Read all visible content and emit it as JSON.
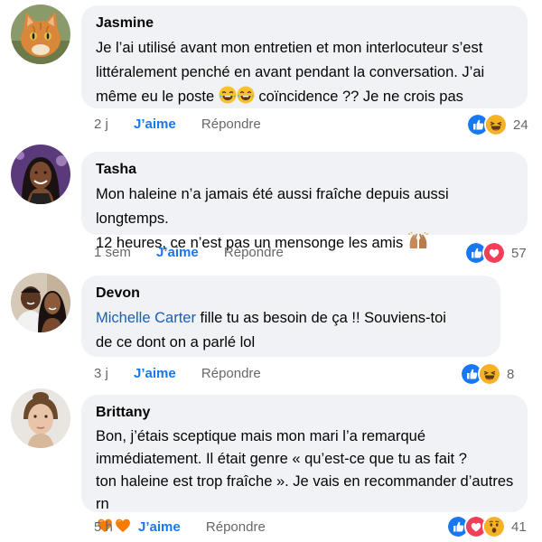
{
  "comments": [
    {
      "name": "Jasmine",
      "lines": [
        "Je l’ai utilisé avant mon entretien et mon interlocuteur s’est",
        "littéralement penché en avant pendant la conversation. J’ai"
      ],
      "line3_before": "même eu le poste ",
      "line3_after": " coïncidence ?? Je ne crois pas",
      "time": "2 j",
      "like": "J’aime",
      "reply": "Répondre",
      "count": "24",
      "reactions": [
        "like",
        "haha"
      ]
    },
    {
      "name": "Tasha",
      "lines": [
        "Mon haleine n’a jamais été aussi fraîche depuis aussi longtemps."
      ],
      "line2_before": "12 heures, ce n’est pas un mensonge les amis ",
      "time": "1 sem",
      "like": "J’aime",
      "reply": "Répondre",
      "count": "57",
      "reactions": [
        "like",
        "love"
      ]
    },
    {
      "name": "Devon",
      "mention": "Michelle Carter",
      "line1_rest": " fille tu as besoin de ça !! Souviens-toi",
      "line2": "de ce dont on a parlé lol",
      "time": "3 j",
      "like": "J’aime",
      "reply": "Répondre",
      "count": "8",
      "reactions": [
        "like",
        "haha"
      ]
    },
    {
      "name": "Brittany",
      "lines": [
        "Bon, j’étais sceptique mais mon mari l’a remarqué",
        "immédiatement. Il était genre « qu’est-ce que tu as fait ?",
        "ton haleine est trop fraîche ». Je vais en recommander d’autres rn"
      ],
      "time": "5 h",
      "like": "J’aime",
      "reply": "Répondre",
      "count": "41",
      "reactions": [
        "like",
        "love",
        "wow"
      ]
    }
  ],
  "colors": {
    "like_blue": "#1877f2",
    "bubble_bg": "#f0f2f5",
    "meta_gray": "#65676b",
    "love_red": "#f33e58",
    "haha_yellow": "#f7b125"
  }
}
